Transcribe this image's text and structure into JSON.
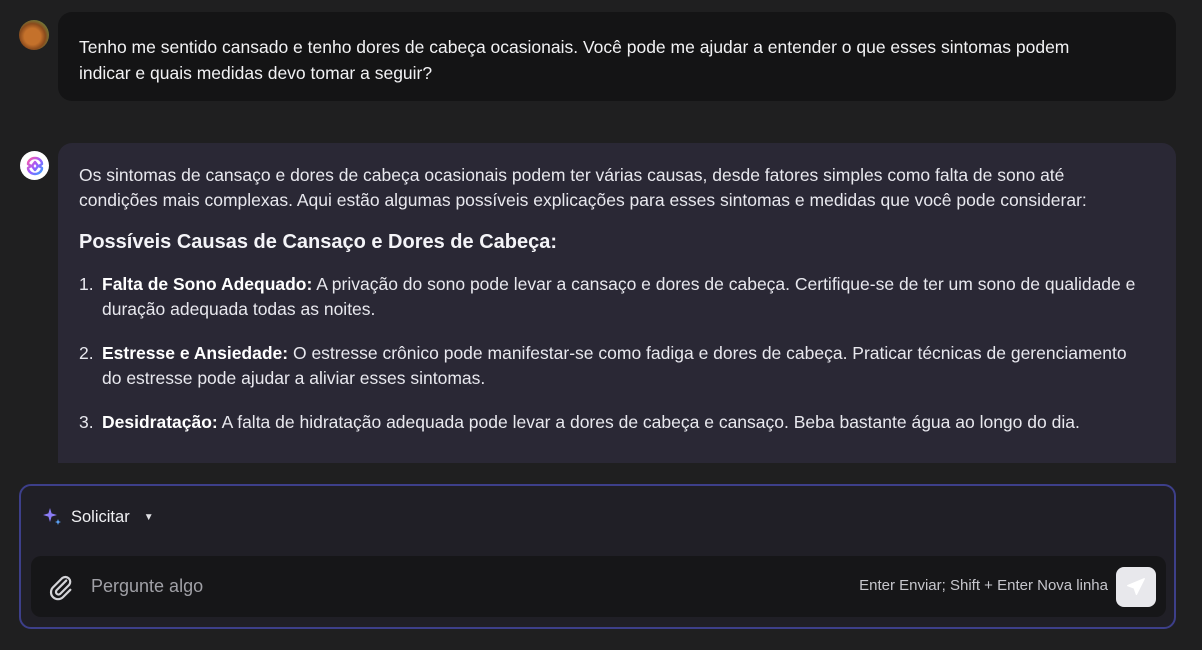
{
  "user": {
    "message": "Tenho me sentido cansado e tenho dores de cabeça ocasionais. Você pode me ajudar a entender o que esses sintomas podem indicar e quais medidas devo tomar a seguir?"
  },
  "assistant": {
    "intro": "Os sintomas de cansaço e dores de cabeça ocasionais podem ter várias causas, desde fatores simples como falta de sono até condições mais complexas. Aqui estão algumas possíveis explicações para esses sintomas e medidas que você pode considerar:",
    "heading": "Possíveis Causas de Cansaço e Dores de Cabeça:",
    "items": [
      {
        "num": "1.",
        "title": "Falta de Sono Adequado:",
        "text": " A privação do sono pode levar a cansaço e dores de cabeça. Certifique-se de ter um sono de qualidade e duração adequada todas as noites."
      },
      {
        "num": "2.",
        "title": "Estresse e Ansiedade:",
        "text": " O estresse crônico pode manifestar-se como fadiga e dores de cabeça. Praticar técnicas de gerenciamento do estresse pode ajudar a aliviar esses sintomas."
      },
      {
        "num": "3.",
        "title": "Desidratação:",
        "text": " A falta de hidratação adequada pode levar a dores de cabeça e cansaço. Beba bastante água ao longo do dia."
      }
    ]
  },
  "composer": {
    "mode_label": "Solicitar",
    "placeholder": "Pergunte algo",
    "hint": "Enter Enviar; Shift + Enter Nova linha"
  },
  "icons": {
    "mode": "sparkle-icon",
    "mode_caret": "caret-down-icon",
    "attach": "paperclip-icon",
    "send": "send-icon",
    "bot": "assistant-logo-icon"
  },
  "colors": {
    "background": "#1f1f20",
    "user_bubble": "#141415",
    "assistant_bubble": "#2a2835",
    "composer_border": "#3d3f8a",
    "sparkle": "#8b7cf6"
  }
}
